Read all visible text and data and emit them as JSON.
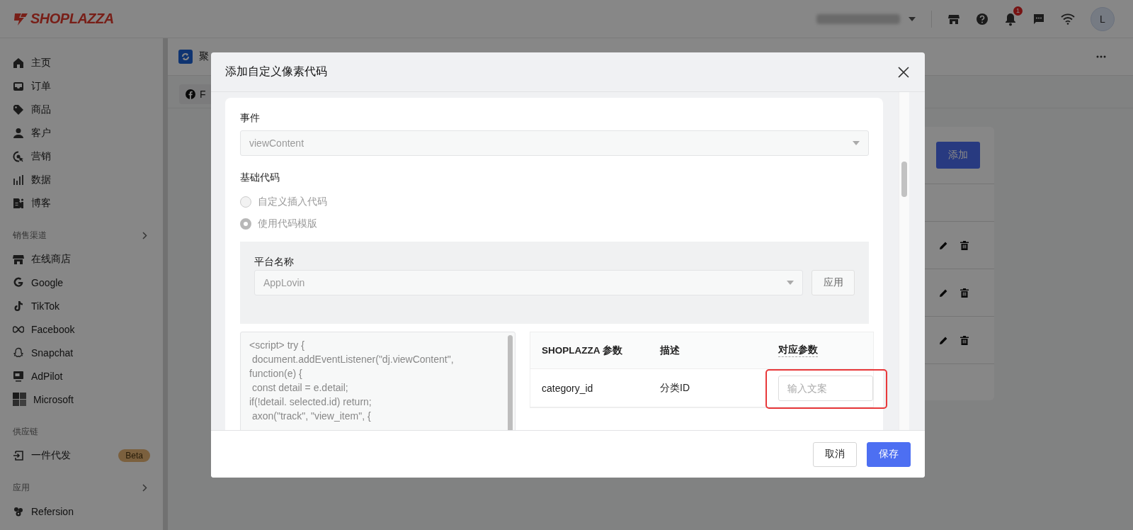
{
  "brand": {
    "logo_text": "SHOPLAZZA"
  },
  "topbar": {
    "notification_count": "1",
    "avatar_initial": "L"
  },
  "sidebar": {
    "sections": [
      {
        "items": [
          {
            "label": "主页"
          },
          {
            "label": "订单"
          },
          {
            "label": "商品"
          },
          {
            "label": "客户"
          },
          {
            "label": "营销"
          },
          {
            "label": "数据"
          },
          {
            "label": "博客"
          }
        ]
      },
      {
        "title": "销售渠道",
        "expandable": true,
        "items": [
          {
            "label": "在线商店"
          },
          {
            "label": "Google"
          },
          {
            "label": "TikTok"
          },
          {
            "label": "Facebook"
          },
          {
            "label": "Snapchat"
          },
          {
            "label": "AdPilot"
          },
          {
            "label": "Microsoft"
          }
        ]
      },
      {
        "title": "供应链",
        "expandable": false,
        "items": [
          {
            "label": "一件代发",
            "badge": "Beta"
          }
        ]
      },
      {
        "title": "应用",
        "expandable": true,
        "items": [
          {
            "label": "Refersion"
          }
        ]
      }
    ]
  },
  "page": {
    "header_title": "聚",
    "tab_label": "F",
    "add_button": "添加",
    "rows": [
      {
        "editable": true
      },
      {
        "editable": true
      },
      {
        "editable": true
      }
    ]
  },
  "modal": {
    "title": "添加自定义像素代码",
    "event": {
      "label": "事件",
      "value": "viewContent",
      "disabled": true
    },
    "base_code": {
      "label": "基础代码",
      "options": [
        {
          "label": "自定义插入代码",
          "selected": false,
          "disabled": true
        },
        {
          "label": "使用代码模版",
          "selected": true,
          "disabled": true
        }
      ]
    },
    "platform": {
      "label": "平台名称",
      "value": "AppLovin",
      "apply_button": "应用"
    },
    "code": "<script> try {\n document.addEventListener(\"dj.viewContent\",\nfunction(e) {\n const detail = e.detail;\nif(!detail. selected.id) return;\n axon(\"track\", \"view_item\", {",
    "param_table": {
      "columns": [
        "SHOPLAZZA 参数",
        "描述",
        "对应参数"
      ],
      "rows": [
        {
          "param": "category_id",
          "description": "分类ID",
          "placeholder": "输入文案",
          "highlighted": true
        }
      ]
    },
    "buttons": [
      {
        "label": "取消",
        "kind": "secondary"
      },
      {
        "label": "保存",
        "kind": "primary"
      }
    ]
  }
}
